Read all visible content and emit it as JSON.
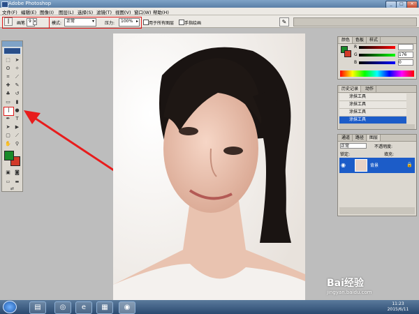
{
  "app": {
    "title": "Adobe Photoshop"
  },
  "menu": [
    "文件(F)",
    "编辑(E)",
    "图像(I)",
    "图层(L)",
    "选择(S)",
    "滤镜(T)",
    "视图(V)",
    "窗口(W)",
    "帮助(H)"
  ],
  "options": {
    "brush_label": "画笔",
    "brush_size": "9",
    "mode_label": "模式:",
    "mode_value": "正常",
    "pressure_label": "压力:",
    "pressure_value": "100%",
    "all_layers_label": "用于所有图层",
    "finger_paint_label": "手指绘画"
  },
  "color_panel": {
    "tabs": [
      "颜色",
      "色板",
      "样式"
    ],
    "channels": [
      {
        "name": "R",
        "value": ""
      },
      {
        "name": "G",
        "value": "176"
      },
      {
        "name": "B",
        "value": "0"
      }
    ],
    "foreground": "#1a8a2a",
    "background": "#d23a2a"
  },
  "history_panel": {
    "tabs": [
      "历史记录",
      "动作"
    ],
    "items": [
      "涂抹工具",
      "涂抹工具",
      "涂抹工具",
      "涂抹工具"
    ]
  },
  "layers_panel": {
    "tabs": [
      "通道",
      "路径",
      "图层"
    ],
    "blend_mode": "正常",
    "opacity_label": "不透明度:",
    "fill_label": "填充:",
    "lock_label": "锁定:",
    "layer_name": "背景"
  },
  "taskbar": {
    "time": "11:23",
    "date": "2015/6/11"
  },
  "watermark": {
    "brand": "Bai经验",
    "url": "jingyan.baidu.com"
  }
}
